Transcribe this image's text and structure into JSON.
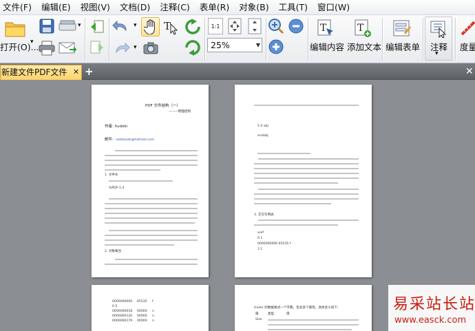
{
  "menu": [
    "文件(F)",
    "编辑(E)",
    "视图(V)",
    "文档(D)",
    "注释(C)",
    "表单(R)",
    "对象(B)",
    "工具(T)",
    "窗口(W)"
  ],
  "toolbar": {
    "open_label": "打开(O)...",
    "zoom_value": "25%",
    "fit_page_label": "1:1",
    "edit_content_label": "编辑内容",
    "add_text_label": "添加文本",
    "edit_form_label": "编辑表单",
    "annotation_label": "注释",
    "measure_label": "度量"
  },
  "tabs": {
    "document_title": "新建文件PDF文件",
    "close": "✕",
    "add": "+",
    "close_all": "✕"
  },
  "pages": {
    "page1": {
      "title": "PDF 文件结构（一）",
      "subtitle": "———物理结构",
      "author_label": "作者: hudoki",
      "email_label": "邮件: ",
      "email": "netdoooki@hotmail.com",
      "section1": "1. 文件头",
      "header_code": "%PDF-1.4",
      "section2": "2. 对象集合"
    },
    "page2": {
      "code1": "5 0 obj",
      "code2": "endobj",
      "section3": "3. 交叉引用表",
      "xref": "xref",
      "xref_row1": "0 1",
      "xref_row2": "0000000000  65535  f",
      "xref_row3": "3 1"
    },
    "page3": {
      "rows": [
        [
          "0000000000",
          "65535",
          "f"
        ],
        [
          "0 5",
          "",
          ""
        ],
        [
          "0000000018",
          "00000",
          "n"
        ],
        [
          "0000000120",
          "00000",
          "n"
        ],
        [
          "0000000179",
          "00000",
          "n"
        ]
      ]
    },
    "page4": {
      "line1": "trailer 的数据格式一个字典，包含多个属性，具体含义如下：",
      "col1": "属",
      "col2": "类型",
      "col3": "值",
      "row_key": "Size"
    }
  },
  "watermark": {
    "title": "易采站长站",
    "url": "www.easck.com"
  },
  "colors": {
    "tab_active": "#ffd36a",
    "doc_background": "#8b8e92",
    "watermark": "#c81d11"
  }
}
